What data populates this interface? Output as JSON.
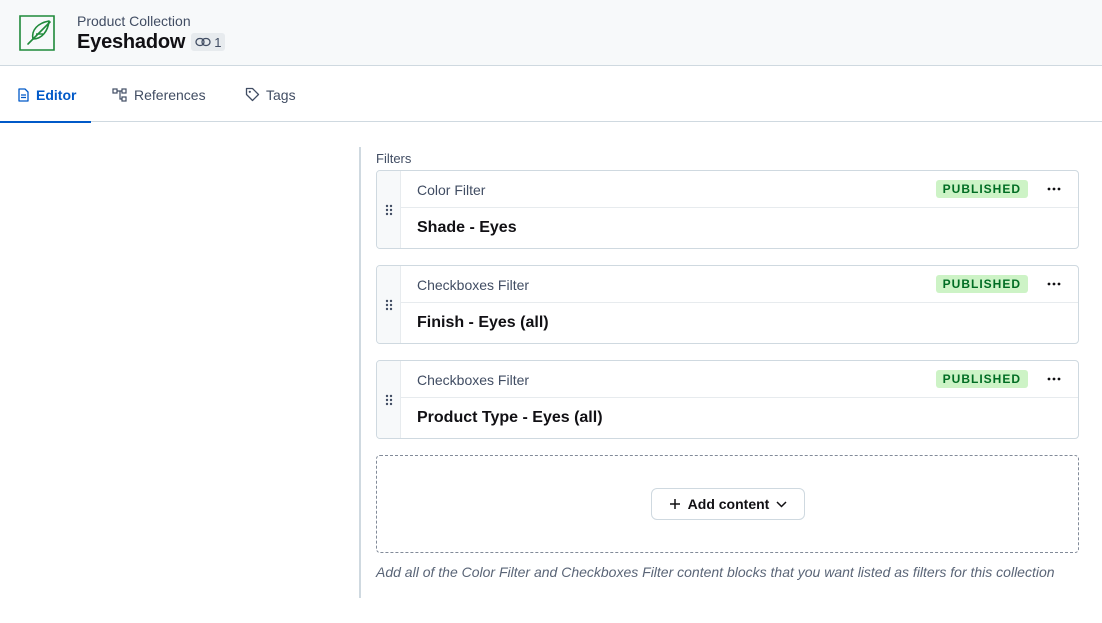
{
  "header": {
    "content_type": "Product Collection",
    "title": "Eyeshadow",
    "references_count": "1",
    "entry_icon": "feather-icon",
    "link_icon": "link-icon"
  },
  "tabs": [
    {
      "label": "Editor",
      "icon": "document-icon",
      "active": true
    },
    {
      "label": "References",
      "icon": "references-icon",
      "active": false
    },
    {
      "label": "Tags",
      "icon": "tag-icon",
      "active": false
    }
  ],
  "field": {
    "label": "Filters",
    "entries": [
      {
        "content_type": "Color Filter",
        "status": "PUBLISHED",
        "title": "Shade - Eyes"
      },
      {
        "content_type": "Checkboxes Filter",
        "status": "PUBLISHED",
        "title": "Finish - Eyes (all)"
      },
      {
        "content_type": "Checkboxes Filter",
        "status": "PUBLISHED",
        "title": "Product Type - Eyes (all)"
      }
    ],
    "add_button_label": "Add content",
    "help_text": "Add all of the Color Filter and Checkboxes Filter content blocks that you want listed as filters for this collection"
  },
  "colors": {
    "accent": "#0059c8",
    "brand_icon": "#1f8a3a",
    "published_bg": "#cdf3c6",
    "published_text": "#006d23"
  }
}
